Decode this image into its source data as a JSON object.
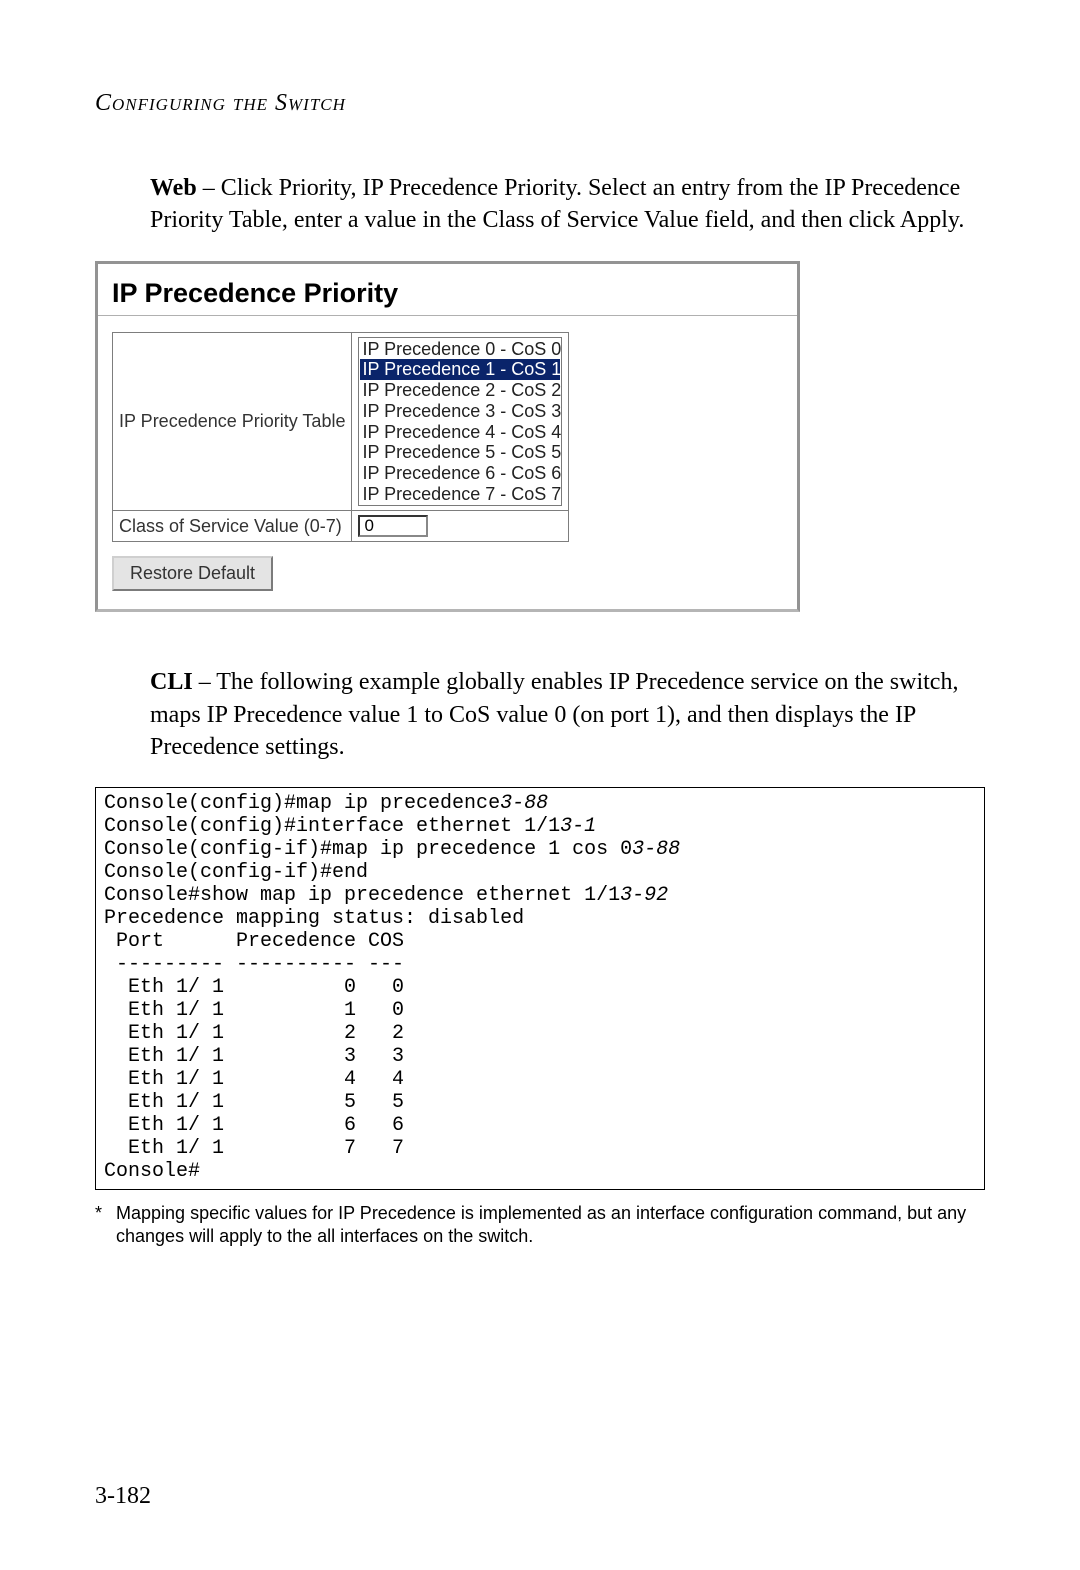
{
  "chapterTitle": "Configuring the Switch",
  "web": {
    "lead": "Web",
    "text": " – Click Priority, IP Precedence Priority. Select an entry from the IP Precedence Priority Table, enter a value in the Class of Service Value field, and then click Apply."
  },
  "panel": {
    "heading": "IP Precedence Priority",
    "tableLabel": "IP Precedence Priority Table",
    "options": [
      "IP Precedence 0 - CoS 0",
      "IP Precedence 1 - CoS 1",
      "IP Precedence 2 - CoS 2",
      "IP Precedence 3 - CoS 3",
      "IP Precedence 4 - CoS 4",
      "IP Precedence 5 - CoS 5",
      "IP Precedence 6 - CoS 6",
      "IP Precedence 7 - CoS 7"
    ],
    "selectedIndex": 1,
    "cosLabel": "Class of Service Value (0-7)",
    "cosValue": "0",
    "restoreBtn": "Restore Default"
  },
  "cli": {
    "lead": "CLI",
    "text": " – The following example globally enables IP Precedence service on the switch, maps IP Precedence value 1 to CoS value 0 (on port 1), and then displays the IP Precedence settings.",
    "lines": [
      {
        "t": "Console(config)#map ip precedence",
        "i": "3-88"
      },
      {
        "t": "Console(config)#interface ethernet 1/1",
        "i": "3-1"
      },
      {
        "t": "Console(config-if)#map ip precedence 1 cos 0",
        "i": "3-88"
      },
      {
        "t": "Console(config-if)#end"
      },
      {
        "t": "Console#show map ip precedence ethernet 1/1",
        "i": "3-92"
      },
      {
        "t": "Precedence mapping status: disabled"
      },
      {
        "t": ""
      },
      {
        "t": " Port      Precedence COS"
      },
      {
        "t": " --------- ---------- ---"
      },
      {
        "t": "  Eth 1/ 1          0   0"
      },
      {
        "t": "  Eth 1/ 1          1   0"
      },
      {
        "t": "  Eth 1/ 1          2   2"
      },
      {
        "t": "  Eth 1/ 1          3   3"
      },
      {
        "t": "  Eth 1/ 1          4   4"
      },
      {
        "t": "  Eth 1/ 1          5   5"
      },
      {
        "t": "  Eth 1/ 1          6   6"
      },
      {
        "t": "  Eth 1/ 1          7   7"
      },
      {
        "t": "Console#"
      }
    ]
  },
  "footnote": {
    "mark": "*",
    "text": "Mapping specific values for IP Precedence is implemented as an interface configuration command, but any changes will apply to the all interfaces on the switch."
  },
  "pageNumber": "3-182"
}
